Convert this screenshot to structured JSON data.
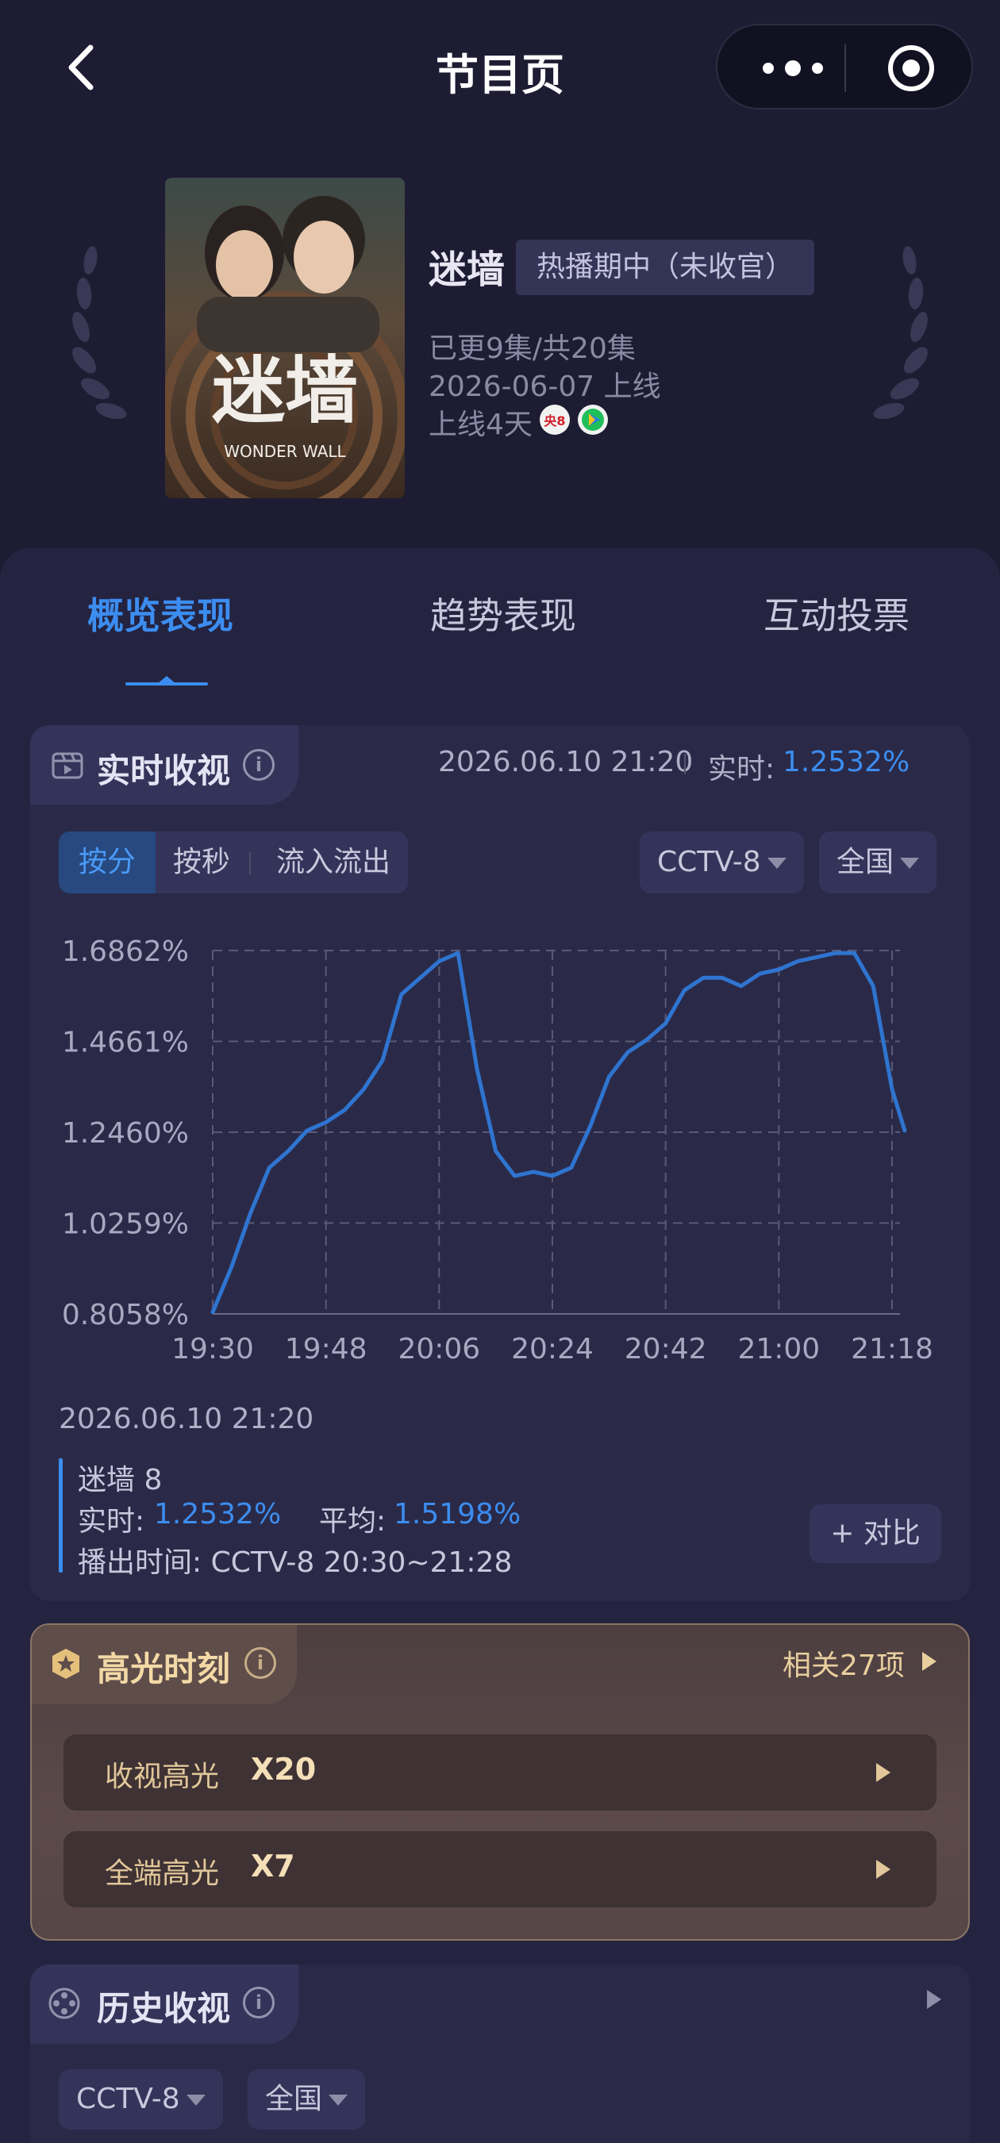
{
  "header": {
    "title": "节目页"
  },
  "show": {
    "name": "迷墙",
    "status": "热播期中（未收官）",
    "episodes": "已更9集/共20集",
    "premiere": "2026-06-07 上线",
    "days_online": "上线4天",
    "poster_title": "迷墙",
    "poster_subtitle": "WONDER WALL",
    "channel_badge": "央8"
  },
  "tabs": [
    {
      "label": "概览表现",
      "active": true
    },
    {
      "label": "趋势表现",
      "active": false
    },
    {
      "label": "互动投票",
      "active": false
    }
  ],
  "realtime": {
    "title": "实时收视",
    "timestamp": "2026.06.10 21:20",
    "realtime_label": "实时:",
    "realtime_value": "1.2532%",
    "segments": [
      "按分",
      "按秒",
      "流入流出"
    ],
    "active_segment": "按分",
    "channel": "CCTV-8",
    "region": "全国",
    "tooltip": {
      "date": "2026.06.10 21:20",
      "name": "迷墙 8",
      "realtime_label": "实时:",
      "realtime_value": "1.2532%",
      "avg_label": "平均:",
      "avg_value": "1.5198%",
      "airtime": "播出时间: CCTV-8 20:30~21:28"
    },
    "compare_label": "+ 对比"
  },
  "chart_data": {
    "type": "line",
    "x_ticks": [
      "19:30",
      "19:48",
      "20:06",
      "20:24",
      "20:42",
      "21:00",
      "21:18"
    ],
    "y_ticks": [
      "0.8058%",
      "1.0259%",
      "1.2460%",
      "1.4661%",
      "1.6862%"
    ],
    "ylim": [
      0.8058,
      1.6862
    ],
    "xlim_minutes": [
      "19:30",
      "21:18"
    ],
    "grid": true,
    "line_color": "#2f74d0",
    "series": [
      {
        "x": [
          "19:30",
          "19:33",
          "19:36",
          "19:39",
          "19:42",
          "19:45",
          "19:48",
          "19:51",
          "19:54",
          "19:57",
          "20:00",
          "20:03",
          "20:06",
          "20:09",
          "20:12",
          "20:15",
          "20:18",
          "20:21",
          "20:24",
          "20:27",
          "20:30",
          "20:33",
          "20:36",
          "20:39",
          "20:42",
          "20:45",
          "20:48",
          "20:51",
          "20:54",
          "20:57",
          "21:00",
          "21:03",
          "21:06",
          "21:09",
          "21:12",
          "21:15",
          "21:18",
          "21:20"
        ],
        "values": [
          0.81,
          0.92,
          1.05,
          1.16,
          1.2,
          1.25,
          1.27,
          1.3,
          1.35,
          1.42,
          1.58,
          1.62,
          1.66,
          1.68,
          1.4,
          1.2,
          1.14,
          1.15,
          1.14,
          1.16,
          1.26,
          1.38,
          1.44,
          1.47,
          1.51,
          1.59,
          1.62,
          1.62,
          1.6,
          1.63,
          1.64,
          1.66,
          1.67,
          1.68,
          1.68,
          1.6,
          1.35,
          1.25
        ]
      }
    ]
  },
  "highlights": {
    "title": "高光时刻",
    "related": "相关27项",
    "rows": [
      {
        "label": "收视高光",
        "value": "X20"
      },
      {
        "label": "全端高光",
        "value": "X7"
      }
    ]
  },
  "history": {
    "title": "历史收视",
    "channel": "CCTV-8",
    "region": "全国"
  },
  "colors": {
    "accent": "#3c8df0",
    "background": "#1d1c33",
    "card": "#2a2a48",
    "highlight_gold": "#f3d9a6"
  }
}
